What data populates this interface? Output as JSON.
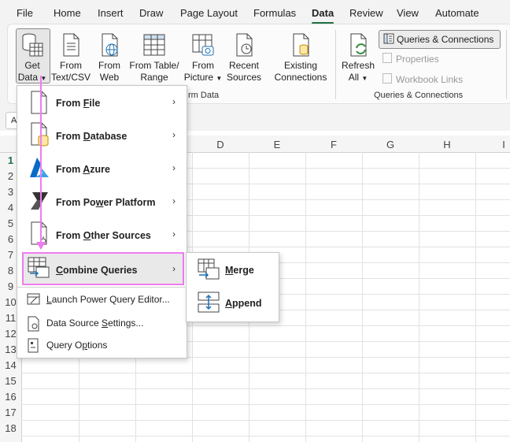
{
  "tabs": [
    {
      "label": "File"
    },
    {
      "label": "Home"
    },
    {
      "label": "Insert"
    },
    {
      "label": "Draw"
    },
    {
      "label": "Page Layout"
    },
    {
      "label": "Formulas"
    },
    {
      "label": "Data",
      "active": true
    },
    {
      "label": "Review"
    },
    {
      "label": "View"
    },
    {
      "label": "Automate"
    }
  ],
  "ribbon": {
    "get_data": {
      "line1": "Get",
      "line2": "Data"
    },
    "from_text_csv": {
      "line1": "From",
      "line2": "Text/CSV"
    },
    "from_web": {
      "line1": "From",
      "line2": "Web"
    },
    "from_table_range": {
      "line1": "From Table/",
      "line2": "Range"
    },
    "from_picture": {
      "line1": "From",
      "line2": "Picture"
    },
    "recent_sources": {
      "line1": "Recent",
      "line2": "Sources"
    },
    "existing_connections": {
      "line1": "Existing",
      "line2": "Connections"
    },
    "group_get_transform_partial": "rm Data",
    "refresh_all": {
      "line1": "Refresh",
      "line2": "All"
    },
    "queries_connections_btn": "Queries & Connections",
    "properties": "Properties",
    "workbook_links": "Workbook Links",
    "group_queries_connections": "Queries & Connections"
  },
  "formula_bar": {
    "name_box": "A"
  },
  "grid": {
    "columns": [
      "D",
      "E",
      "F",
      "G",
      "H",
      "I"
    ],
    "rows": [
      "1",
      "2",
      "3",
      "4",
      "5",
      "6",
      "7",
      "8",
      "9",
      "10",
      "11",
      "12",
      "13",
      "14",
      "15",
      "16",
      "17",
      "18"
    ]
  },
  "menu": {
    "items": [
      {
        "pre": "From ",
        "key": "F",
        "post": "ile"
      },
      {
        "pre": "From ",
        "key": "D",
        "post": "atabase"
      },
      {
        "pre": "From ",
        "key": "A",
        "post": "zure"
      },
      {
        "pre": "From Po",
        "key": "w",
        "post": "er Platform"
      },
      {
        "pre": "From ",
        "key": "O",
        "post": "ther Sources"
      },
      {
        "pre": "",
        "key": "C",
        "post": "ombine Queries"
      }
    ],
    "launch_pq": {
      "pre": "",
      "key": "L",
      "post": "aunch Power Query Editor..."
    },
    "data_source_settings": {
      "pre": "Data Source ",
      "key": "S",
      "post": "ettings..."
    },
    "query_options": {
      "pre": "Query O",
      "key": "p",
      "post": "tions"
    }
  },
  "submenu": {
    "merge": {
      "pre": "",
      "key": "M",
      "post": "erge"
    },
    "append": {
      "pre": "",
      "key": "A",
      "post": "ppend"
    }
  },
  "colors": {
    "highlight": "#f07cf0",
    "excel_green": "#1e7145"
  }
}
